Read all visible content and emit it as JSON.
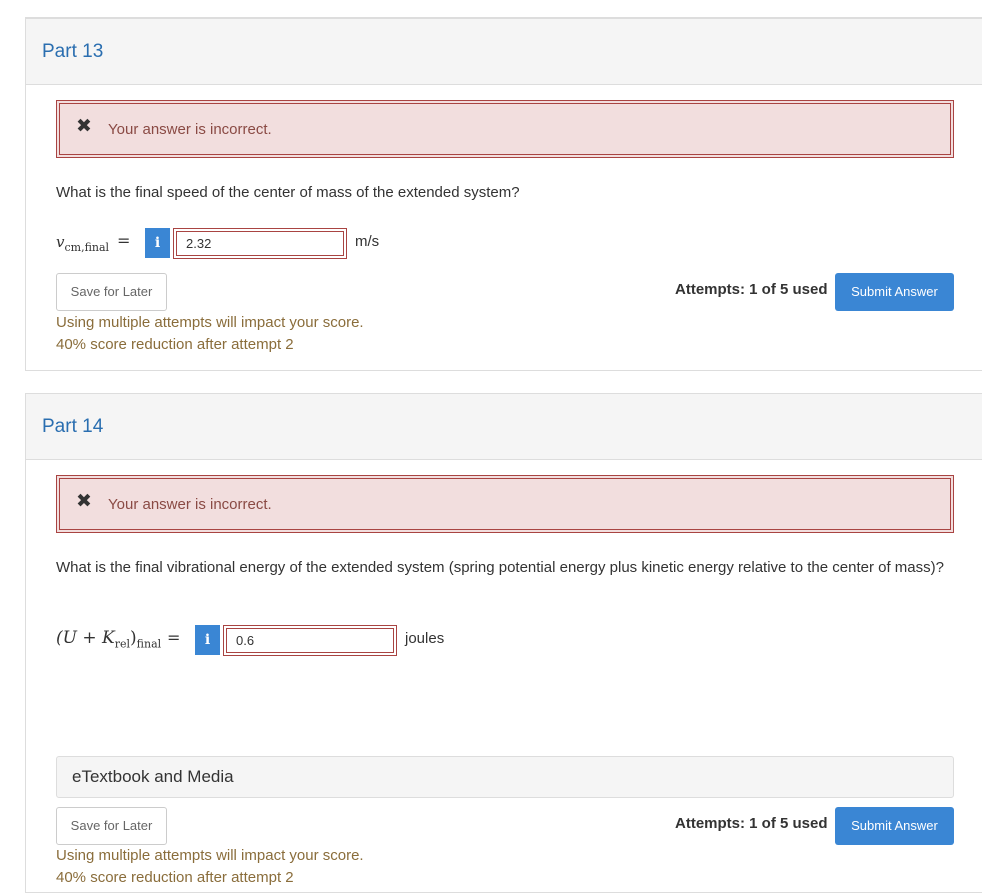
{
  "part13": {
    "title": "Part 13",
    "alert_text": "Your answer is incorrect.",
    "question": "What is the final speed of the center of mass of the extended system?",
    "var_symbol": "v",
    "var_subscript": "cm,final",
    "equals": "=",
    "info_icon_glyph": "i",
    "answer_value": "2.32",
    "unit": "m/s",
    "save_label": "Save for Later",
    "attempts": "Attempts: 1 of 5 used",
    "submit_label": "Submit Answer",
    "warning_line1": "Using multiple attempts will impact your score.",
    "warning_line2": "40% score reduction after attempt 2"
  },
  "part14": {
    "title": "Part 14",
    "alert_text": "Your answer is incorrect.",
    "question": "What is the final vibrational energy of the extended system (spring potential energy plus kinetic energy relative to the center of mass)?",
    "expr_main": "(U + K",
    "expr_sub_rel": "rel",
    "expr_close": ")",
    "expr_sub_final": "final",
    "equals": "=",
    "info_icon_glyph": "i",
    "answer_value": "0.6",
    "unit": "joules",
    "etextbook_label": "eTextbook and Media",
    "save_label": "Save for Later",
    "attempts": "Attempts: 1 of 5 used",
    "submit_label": "Submit Answer",
    "warning_line1": "Using multiple attempts will impact your score.",
    "warning_line2": "40% score reduction after attempt 2"
  },
  "icons": {
    "incorrect_icon": "x-mark-icon",
    "info_icon": "info-icon"
  },
  "colors": {
    "title_blue": "#2a6eb0",
    "error_bg": "#f2dede",
    "error_border": "#a94442",
    "primary_button": "#3a86d4",
    "warning_text": "#8a6d3b"
  }
}
